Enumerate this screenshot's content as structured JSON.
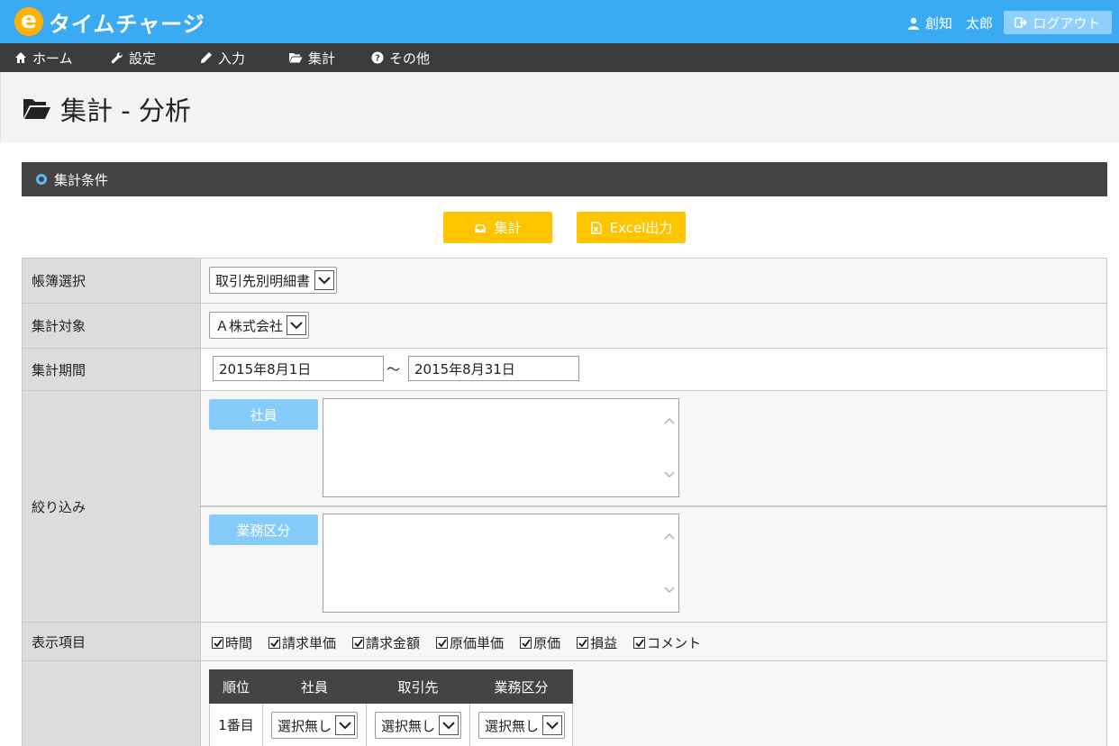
{
  "app": {
    "logo_letter": "e",
    "logo_text": "タイムチャージ",
    "user_name": "創知　太郎",
    "logout_label": "ログアウト"
  },
  "nav": [
    {
      "label": "ホーム",
      "icon": "home-icon"
    },
    {
      "label": "設定",
      "icon": "wrench-icon"
    },
    {
      "label": "入力",
      "icon": "pencil-icon"
    },
    {
      "label": "集計",
      "icon": "folder-open-icon"
    },
    {
      "label": "その他",
      "icon": "question-circle-icon"
    }
  ],
  "page": {
    "title": "集計 - 分析"
  },
  "section": {
    "title": "集計条件"
  },
  "actions": {
    "aggregate_label": "集計",
    "excel_label": "Excel出力"
  },
  "form": {
    "ledger": {
      "label": "帳簿選択",
      "value": "取引先別明細書"
    },
    "target": {
      "label": "集計対象",
      "value": "Ａ株式会社"
    },
    "period": {
      "label": "集計期間",
      "from": "2015年8月1日",
      "separator": "～",
      "to": "2015年8月31日"
    },
    "filter": {
      "label": "絞り込み",
      "employee_button": "社員",
      "category_button": "業務区分"
    },
    "display": {
      "label": "表示項目",
      "items": [
        {
          "label": "時間",
          "checked": true
        },
        {
          "label": "請求単価",
          "checked": true
        },
        {
          "label": "請求金額",
          "checked": true
        },
        {
          "label": "原価単価",
          "checked": true
        },
        {
          "label": "原価",
          "checked": true
        },
        {
          "label": "損益",
          "checked": true
        },
        {
          "label": "コメント",
          "checked": true
        }
      ]
    },
    "sort": {
      "headers": [
        "順位",
        "社員",
        "取引先",
        "業務区分"
      ],
      "rows": [
        {
          "rank": "1番目",
          "employee": "選択無し",
          "client": "選択無し",
          "category": "選択無し"
        }
      ]
    }
  }
}
